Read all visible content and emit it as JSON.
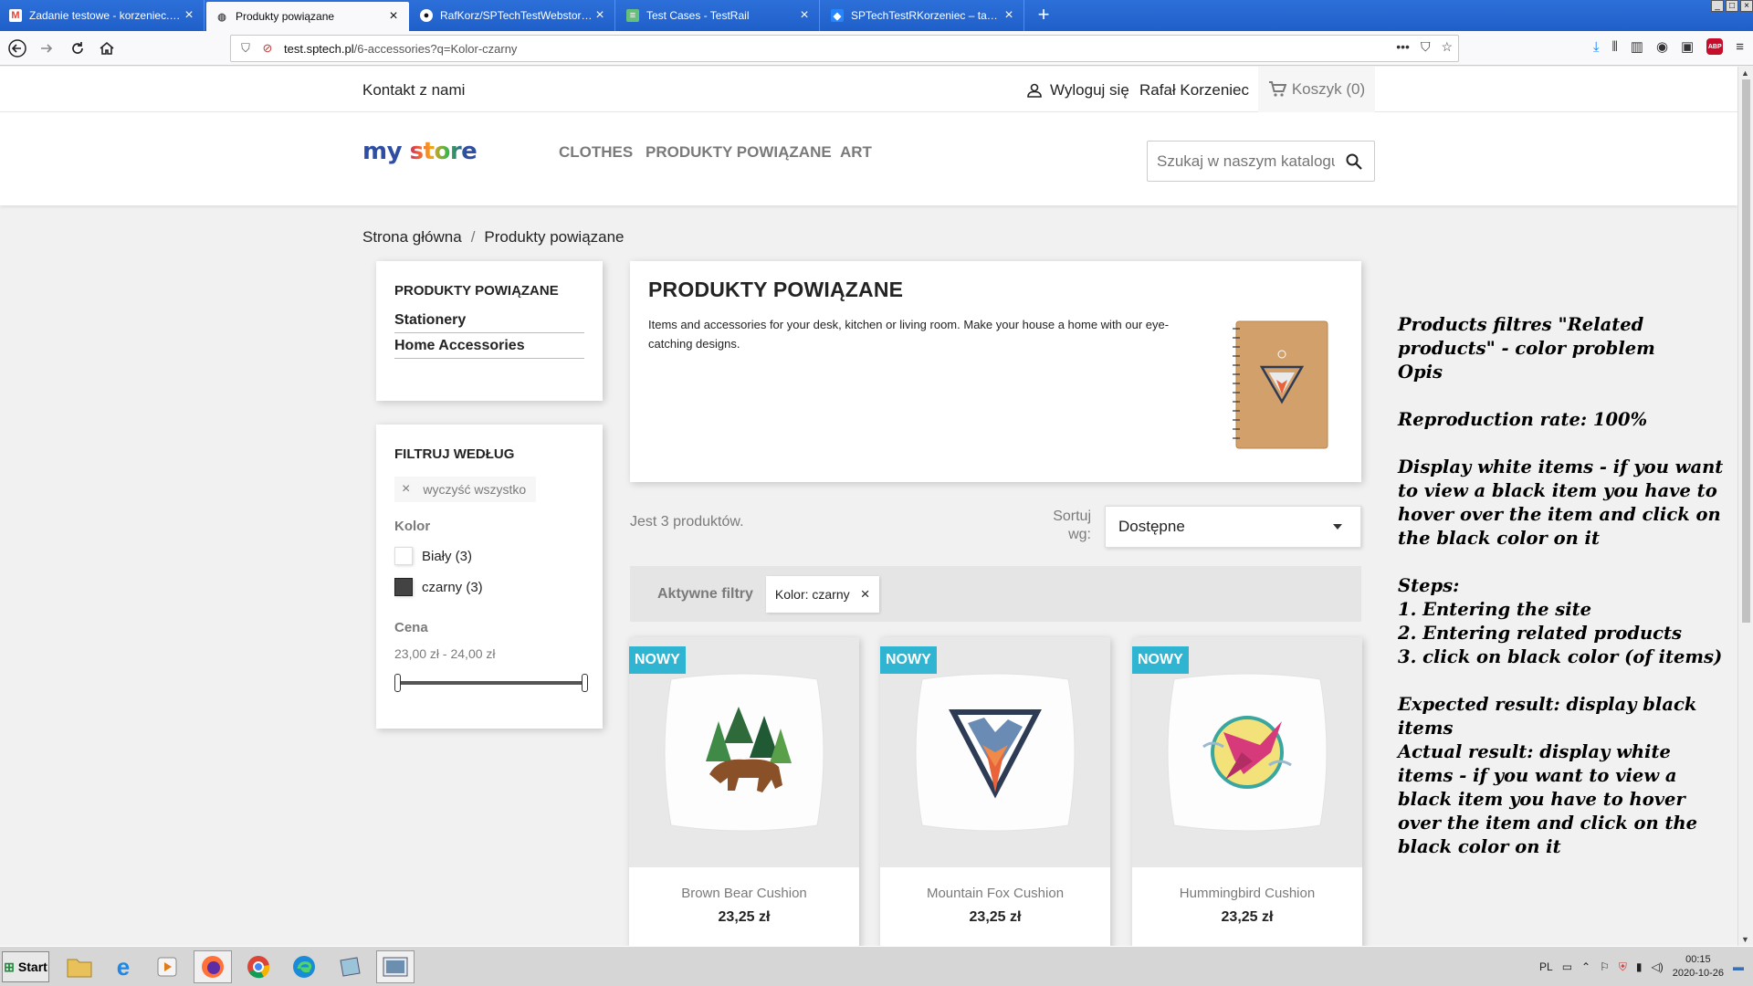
{
  "browser": {
    "tabs": [
      {
        "title": "Zadanie testowe - korzeniec.rafal",
        "icon": "gmail-icon",
        "active": false
      },
      {
        "title": "Produkty powiązane",
        "icon": "store-icon",
        "active": true
      },
      {
        "title": "RafKorz/SPTechTestWebstore: Te",
        "icon": "github-icon",
        "active": false
      },
      {
        "title": "Test Cases - TestRail",
        "icon": "testrail-icon",
        "active": false
      },
      {
        "title": "SPTechTestRKorzeniec – tablica A",
        "icon": "jira-icon",
        "active": false
      }
    ],
    "url_host": "test.sptech.pl",
    "url_path": "/6-accessories?q=Kolor-czarny"
  },
  "store": {
    "contact": "Kontakt z nami",
    "logout": "Wyloguj się",
    "user_name": "Rafał Korzeniec",
    "cart": "Koszyk (0)",
    "logo_text": "my store",
    "menu": [
      "CLOTHES",
      "PRODUKTY POWIĄZANE",
      "ART"
    ],
    "search_placeholder": "Szukaj w naszym katalogu"
  },
  "breadcrumb": [
    "Strona główna",
    "Produkty powiązane"
  ],
  "categories": {
    "title": "PRODUKTY POWIĄZANE",
    "items": [
      "Stationery",
      "Home Accessories"
    ]
  },
  "filters": {
    "title": "FILTRUJ WEDŁUG",
    "clear_all": "wyczyść wszystko",
    "color_title": "Kolor",
    "colors": [
      {
        "label": "Biały (3)",
        "swatch": "#ffffff"
      },
      {
        "label": "czarny (3)",
        "swatch": "#434343"
      }
    ],
    "price_title": "Cena",
    "price_range": "23,00 zł - 24,00 zł"
  },
  "category_header": {
    "title": "PRODUKTY POWIĄZANE",
    "description": "Items and accessories for your desk, kitchen or living room. Make your house a home with our eye-catching designs."
  },
  "listing": {
    "count": "Jest 3 produktów.",
    "sort_label": "Sortuj wg:",
    "sort_value": "Dostępne",
    "active_filters_label": "Aktywne filtry",
    "active_filter": "Kolor: czarny"
  },
  "products": [
    {
      "badge": "NOWY",
      "name": "Brown Bear Cushion",
      "price": "23,25 zł"
    },
    {
      "badge": "NOWY",
      "name": "Mountain Fox Cushion",
      "price": "23,25 zł"
    },
    {
      "badge": "NOWY",
      "name": "Hummingbird Cushion",
      "price": "23,25 zł"
    }
  ],
  "note": {
    "line1": "Products filtres \"Related products\" - color problem",
    "line2": "Opis",
    "line3": "Reproduction rate: 100%",
    "line4": "Display white items - if you want to view a black item you have to hover over the item and click on the black color on it",
    "line5": "Steps:",
    "line6": "1. Entering the site",
    "line7": "2. Entering related products",
    "line8": "3. click on black color (of items)",
    "line9": "Expected result: display black items",
    "line10": "Actual result: display white items - if you want to view a black item you have to hover over the item and click on the black color on it"
  },
  "taskbar": {
    "start": "Start",
    "lang": "PL",
    "time": "00:15",
    "date": "2020-10-26"
  },
  "colors": {
    "accent": "#2fb5d2",
    "browser_blue": "#1f5fc9",
    "text": "#232323",
    "muted": "#7a7a7a"
  }
}
